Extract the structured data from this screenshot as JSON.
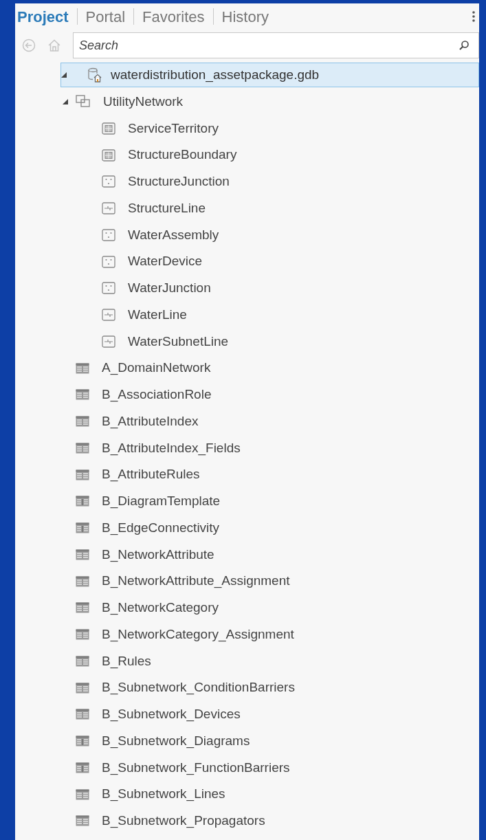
{
  "tabs": [
    {
      "label": "Project",
      "selected": true
    },
    {
      "label": "Portal",
      "selected": false
    },
    {
      "label": "Favorites",
      "selected": false
    },
    {
      "label": "History",
      "selected": false
    }
  ],
  "search": {
    "placeholder": "Search"
  },
  "tree": [
    {
      "label": "waterdistribution_assetpackage.gdb",
      "kind": "geodatabase",
      "expanded": true,
      "selected": true,
      "children": [
        {
          "label": "UtilityNetwork",
          "kind": "utility_network",
          "expanded": true,
          "selected": false,
          "children": [
            {
              "label": "ServiceTerritory",
              "kind": "polygon",
              "selected": false
            },
            {
              "label": "StructureBoundary",
              "kind": "polygon",
              "selected": false
            },
            {
              "label": "StructureJunction",
              "kind": "point",
              "selected": false
            },
            {
              "label": "StructureLine",
              "kind": "line",
              "selected": false
            },
            {
              "label": "WaterAssembly",
              "kind": "point",
              "selected": false
            },
            {
              "label": "WaterDevice",
              "kind": "point",
              "selected": false
            },
            {
              "label": "WaterJunction",
              "kind": "point",
              "selected": false
            },
            {
              "label": "WaterLine",
              "kind": "line",
              "selected": false
            },
            {
              "label": "WaterSubnetLine",
              "kind": "line",
              "selected": false
            }
          ]
        },
        {
          "label": "A_DomainNetwork",
          "kind": "table",
          "selected": false
        },
        {
          "label": "B_AssociationRole",
          "kind": "table",
          "selected": false
        },
        {
          "label": "B_AttributeIndex",
          "kind": "table",
          "selected": false
        },
        {
          "label": "B_AttributeIndex_Fields",
          "kind": "table",
          "selected": false
        },
        {
          "label": "B_AttributeRules",
          "kind": "table",
          "selected": false
        },
        {
          "label": "B_DiagramTemplate",
          "kind": "table_narrow",
          "selected": false
        },
        {
          "label": "B_EdgeConnectivity",
          "kind": "table_narrow",
          "selected": false
        },
        {
          "label": "B_NetworkAttribute",
          "kind": "table",
          "selected": false
        },
        {
          "label": "B_NetworkAttribute_Assignment",
          "kind": "table",
          "selected": false
        },
        {
          "label": "B_NetworkCategory",
          "kind": "table",
          "selected": false
        },
        {
          "label": "B_NetworkCategory_Assignment",
          "kind": "table",
          "selected": false
        },
        {
          "label": "B_Rules",
          "kind": "table",
          "selected": false
        },
        {
          "label": "B_Subnetwork_ConditionBarriers",
          "kind": "table",
          "selected": false
        },
        {
          "label": "B_Subnetwork_Devices",
          "kind": "table",
          "selected": false
        },
        {
          "label": "B_Subnetwork_Diagrams",
          "kind": "table_narrow",
          "selected": false
        },
        {
          "label": "B_Subnetwork_FunctionBarriers",
          "kind": "table_narrow",
          "selected": false
        },
        {
          "label": "B_Subnetwork_Lines",
          "kind": "table",
          "selected": false
        },
        {
          "label": "B_Subnetwork_Propagators",
          "kind": "table",
          "selected": false
        }
      ]
    }
  ]
}
